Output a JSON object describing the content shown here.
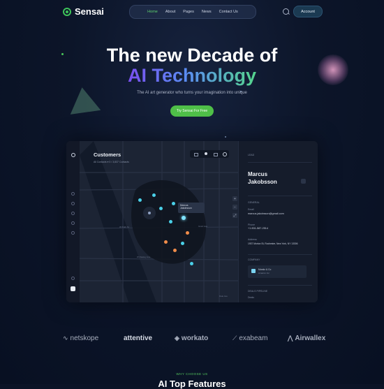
{
  "brand": {
    "name": "Sensai",
    "accent": "#4fbf48"
  },
  "nav": {
    "items": [
      {
        "label": "Home",
        "active": true
      },
      {
        "label": "About",
        "active": false
      },
      {
        "label": "Pages",
        "active": false
      },
      {
        "label": "News",
        "active": false
      },
      {
        "label": "Contact Us",
        "active": false
      }
    ],
    "account_label": "Account"
  },
  "hero": {
    "title_line1": "The new Decade of",
    "title_line2": "AI Technology",
    "subtitle": "The AI art generator who turns your imagination into unique",
    "cta_label": "Try Sensai For Free"
  },
  "dashboard": {
    "title": "Customers",
    "filter_text": "All Contacts ▾     0  /  3,837  Contacts",
    "tooltip_line1": "Marcus",
    "tooltip_line2": "Jakobsson",
    "street_labels": [
      "W Ruth St",
      "Gratz Ave",
      "W Rawley Ave",
      "Dale Ave"
    ],
    "panel": {
      "lead_label": "LEAD",
      "name_line1": "Marcus",
      "name_line2": "Jakobsson",
      "general_label": "GENERAL",
      "email_label": "Email",
      "email_value": "marcus.jakobsson@gmail.com",
      "phone_label": "Phone",
      "phone_value": "+1 831-587-2514",
      "address_label": "Address",
      "address_value": "1937 Morton St, Rochester, New York, NY 13306",
      "company_label": "COMPANY",
      "company_name": "Mondo & Co",
      "company_sub": "Amazon Inc",
      "deals_label": "DEALS PIPELINE",
      "deals_sub": "Deals"
    }
  },
  "logos": [
    {
      "name": "netskope",
      "icon": "netskope-icon"
    },
    {
      "name": "attentive",
      "icon": ""
    },
    {
      "name": "workato",
      "icon": "workato-icon"
    },
    {
      "name": "exabeam",
      "icon": "exabeam-icon"
    },
    {
      "name": "Airwallex",
      "icon": "airwallex-icon"
    }
  ],
  "features": {
    "kicker": "WHY CHOOSE US",
    "title": "AI Top Features"
  }
}
